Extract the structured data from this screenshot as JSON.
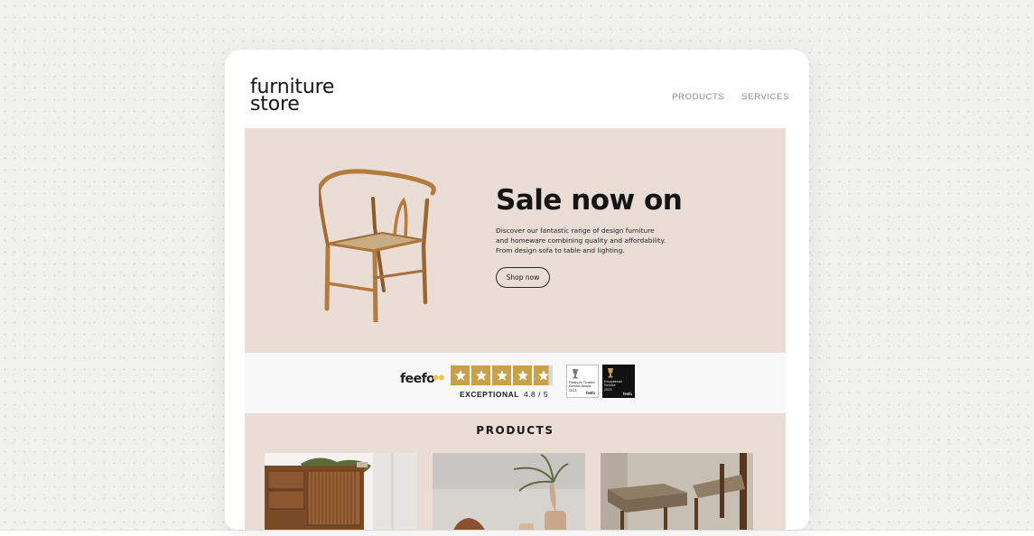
{
  "brand": {
    "line1": "furniture",
    "line2": "store"
  },
  "nav": [
    {
      "label": "PRODUCTS"
    },
    {
      "label": "SERVICES"
    }
  ],
  "hero": {
    "title": "Sale now on",
    "description": "Discover our fantastic range of design furniture and homeware combining quality and affordability. From design sofa to table and lighting.",
    "cta": "Shop now",
    "background": "#e9ddd5"
  },
  "reviews": {
    "provider": "feefo",
    "rating_label": "EXCEPTIONAL",
    "rating_value": "4.8 / 5",
    "stars": 4.8,
    "star_color": "#c9a14a",
    "badges": [
      {
        "title": "Platinum Trusted Service Award",
        "year": "2023",
        "brand": "feefo"
      },
      {
        "title": "Exceptional Service",
        "year": "2023",
        "brand": "feefo"
      }
    ]
  },
  "products": {
    "heading": "PRODUCTS",
    "items": [
      {
        "name": "wooden-sideboard-image"
      },
      {
        "name": "vase-and-plant-image"
      },
      {
        "name": "woven-chairs-image"
      }
    ]
  },
  "icons": [
    "chair-image",
    "star-icon",
    "trophy-icon"
  ]
}
